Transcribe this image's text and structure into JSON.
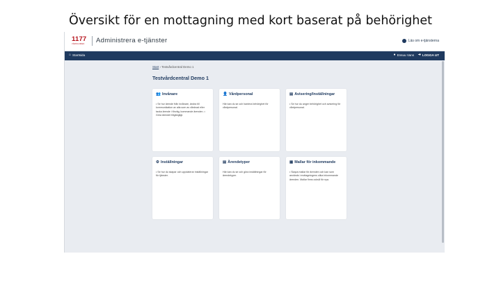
{
  "slide": {
    "title": "Översikt för en mottagning med kort baserat på behörighet"
  },
  "app": {
    "logo_number": "1177",
    "logo_sub": "VÅRDGUIDEN",
    "title": "Administrera e-tjänster",
    "user_link": "Läs om e-tjänsterna"
  },
  "nav": {
    "start": "Startsida",
    "user": "Ensuu Vans",
    "logout": "LOGGA UT"
  },
  "breadcrumb": {
    "home": "Start",
    "separator": "›",
    "current": "Testvårdcentral Demo 1"
  },
  "page": {
    "title": "Testvårdcentral Demo 1"
  },
  "cards": [
    {
      "title": "Invånare",
      "icon": "people-icon",
      "desc": "• Se hur ärende från invånare, ändra till kommunikation av alla som av vårdnad eller tacka ärende i förväg, kommande ärenden. • Göra ärendet tillgängligt."
    },
    {
      "title": "Vårdpersonal",
      "icon": "person-icon",
      "desc": "Här kan du se och hantera behörighet för vårdpersonal."
    },
    {
      "title": "Avisering/Inställningar",
      "icon": "document-icon",
      "desc": "• Se hur du anger behörighet och avisering för vårdpersonal."
    },
    {
      "title": "Inställningar",
      "icon": "gear-icon",
      "desc": "• Se hur du skapar och uppdaterar inställningar för tjänster."
    },
    {
      "title": "Ärendetyper",
      "icon": "document-icon",
      "desc": "Här kan du se och göra inställningar för ärendetyper."
    },
    {
      "title": "Mallar för inkommande",
      "icon": "template-icon",
      "desc": "• Skapa mallar för ärenden och kan som används i mottagningens olika inkommande ärenden. Mallar finns också för nya."
    }
  ]
}
